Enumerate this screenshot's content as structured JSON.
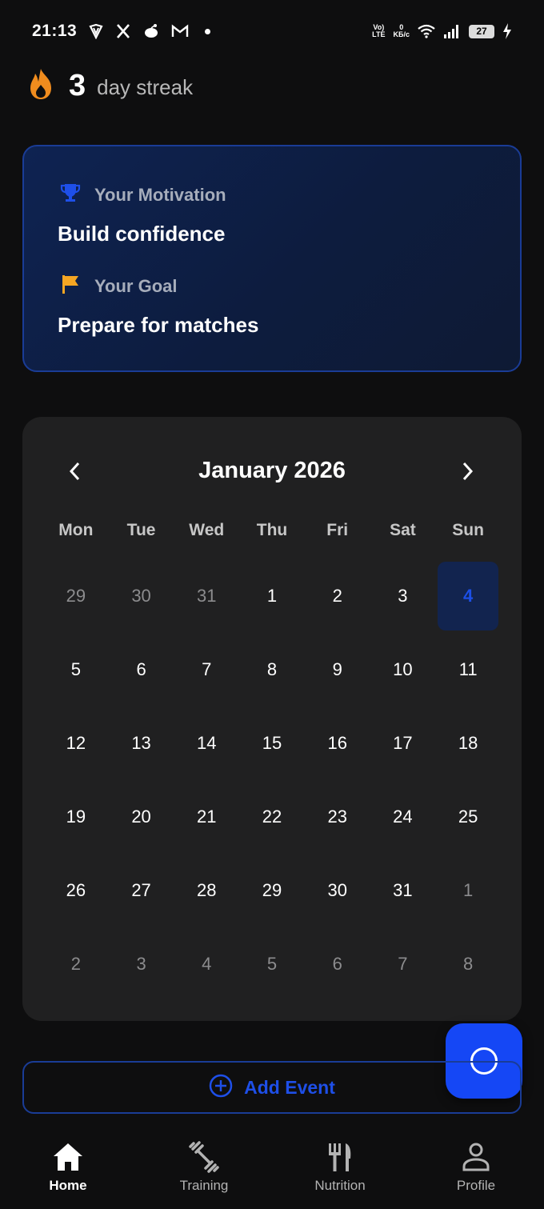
{
  "status_bar": {
    "time": "21:13",
    "net_top": "0",
    "net_unit": "KБ/c",
    "lte_top": "Vo)",
    "lte_bottom": "LTE",
    "battery": "27"
  },
  "streak": {
    "count": "3",
    "label": "day streak",
    "icon": "fire-icon",
    "icon_color": "#f08c1e"
  },
  "motivation_card": {
    "motivation_label": "Your Motivation",
    "motivation_value": "Build confidence",
    "goal_label": "Your Goal",
    "goal_value": "Prepare for matches",
    "trophy_color": "#1e4fe8",
    "flag_color": "#f5a623"
  },
  "calendar": {
    "title": "January 2026",
    "weekdays": [
      "Mon",
      "Tue",
      "Wed",
      "Thu",
      "Fri",
      "Sat",
      "Sun"
    ],
    "days": [
      {
        "d": "29",
        "muted": true
      },
      {
        "d": "30",
        "muted": true
      },
      {
        "d": "31",
        "muted": true
      },
      {
        "d": "1"
      },
      {
        "d": "2"
      },
      {
        "d": "3"
      },
      {
        "d": "4",
        "selected": true
      },
      {
        "d": "5"
      },
      {
        "d": "6"
      },
      {
        "d": "7"
      },
      {
        "d": "8"
      },
      {
        "d": "9"
      },
      {
        "d": "10"
      },
      {
        "d": "11"
      },
      {
        "d": "12"
      },
      {
        "d": "13"
      },
      {
        "d": "14"
      },
      {
        "d": "15"
      },
      {
        "d": "16"
      },
      {
        "d": "17"
      },
      {
        "d": "18"
      },
      {
        "d": "19"
      },
      {
        "d": "20"
      },
      {
        "d": "21"
      },
      {
        "d": "22"
      },
      {
        "d": "23"
      },
      {
        "d": "24"
      },
      {
        "d": "25"
      },
      {
        "d": "26"
      },
      {
        "d": "27"
      },
      {
        "d": "28"
      },
      {
        "d": "29"
      },
      {
        "d": "30"
      },
      {
        "d": "31"
      },
      {
        "d": "1",
        "muted": true
      },
      {
        "d": "2",
        "muted": true
      },
      {
        "d": "3",
        "muted": true
      },
      {
        "d": "4",
        "muted": true
      },
      {
        "d": "5",
        "muted": true
      },
      {
        "d": "6",
        "muted": true
      },
      {
        "d": "7",
        "muted": true
      },
      {
        "d": "8",
        "muted": true
      }
    ]
  },
  "add_event": {
    "label": "Add Event",
    "accent": "#1e4fe8"
  },
  "nav": {
    "items": [
      {
        "label": "Home",
        "icon": "home-icon",
        "active": true
      },
      {
        "label": "Training",
        "icon": "dumbbell-icon"
      },
      {
        "label": "Nutrition",
        "icon": "cutlery-icon"
      },
      {
        "label": "Profile",
        "icon": "person-icon"
      }
    ]
  }
}
